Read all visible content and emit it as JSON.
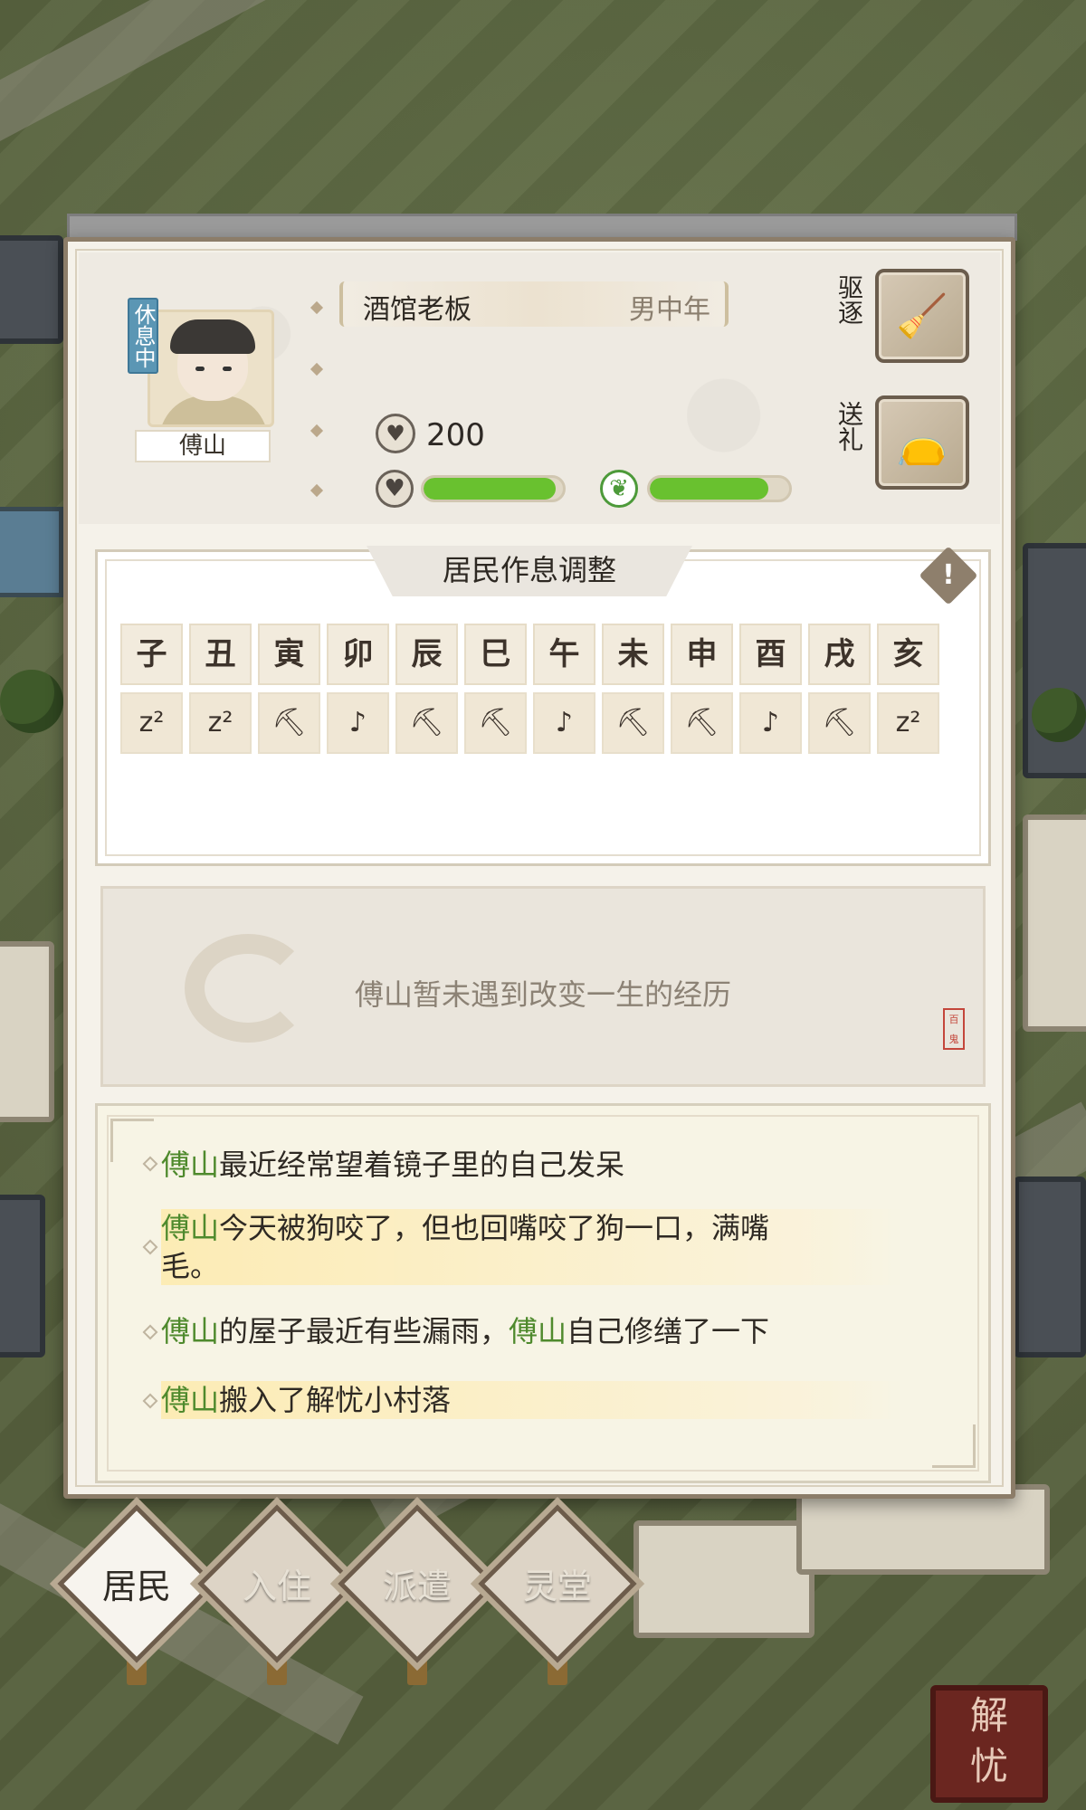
{
  "resident": {
    "status": "休息中",
    "name": "傅山",
    "job": "酒馆老板",
    "gender_age": "男中年",
    "coins": "200",
    "mood_fill": 0.95,
    "health_fill": 0.85
  },
  "actions": {
    "expel_label": "驱逐",
    "gift_label": "送礼"
  },
  "schedule": {
    "title": "居民作息调整",
    "hours": [
      "子",
      "丑",
      "寅",
      "卯",
      "辰",
      "巳",
      "午",
      "未",
      "申",
      "酉",
      "戌",
      "亥"
    ],
    "activities": [
      "z²",
      "z²",
      "⛏",
      "♪",
      "⛏",
      "⛏",
      "♪",
      "⛏",
      "⛏",
      "♪",
      "⛏",
      "z²"
    ],
    "activity_types": [
      "sleep",
      "sleep",
      "work",
      "leisure",
      "work",
      "work",
      "leisure",
      "work",
      "work",
      "leisure",
      "work",
      "sleep"
    ]
  },
  "experience": {
    "text": "傅山暂未遇到改变一生的经历",
    "seal": "百鬼"
  },
  "log": [
    {
      "name": "傅山",
      "text": "最近经常望着镜子里的自己发呆"
    },
    {
      "name": "傅山",
      "text": "今天被狗咬了，但也回嘴咬了狗一口，满嘴"
    },
    {
      "name": "",
      "text": "毛。"
    },
    {
      "name": "傅山",
      "text": "的屋子最近有些漏雨，",
      "name2": "傅山",
      "text2": "自己修缮了一下"
    },
    {
      "name": "傅山",
      "text": "搬入了解忧小村落"
    }
  ],
  "tabs": [
    {
      "label": "居民"
    },
    {
      "label": "入住"
    },
    {
      "label": "派遣"
    },
    {
      "label": "灵堂"
    }
  ],
  "corner_seal": {
    "line1": "解",
    "line2": "忧"
  },
  "colors": {
    "name_green": "#4f8a2d",
    "bar_green": "#69c12f",
    "status_blue": "#5b96b4"
  }
}
